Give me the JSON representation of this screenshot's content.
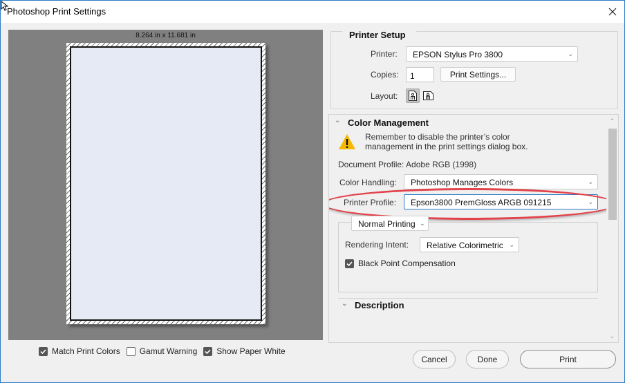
{
  "window": {
    "title": "Photoshop Print Settings",
    "close_icon": "close-x-icon"
  },
  "preview": {
    "paper_dimensions": "8.264 in x 11.681 in",
    "paper_color": "#e6eaf4",
    "background_color": "#808080"
  },
  "preview_options": [
    {
      "label": "Match Print Colors",
      "checked": true
    },
    {
      "label": "Gamut Warning",
      "checked": false
    },
    {
      "label": "Show Paper White",
      "checked": true
    }
  ],
  "printer_setup": {
    "heading": "Printer Setup",
    "printer_label": "Printer:",
    "printer_value": "EPSON Stylus Pro 3800",
    "copies_label": "Copies:",
    "copies_value": "1",
    "print_settings_button": "Print Settings...",
    "layout_label": "Layout:",
    "layout_options": [
      {
        "name": "portrait",
        "icon": "portrait-layout-icon",
        "selected": true
      },
      {
        "name": "landscape",
        "icon": "landscape-layout-icon",
        "selected": false
      }
    ]
  },
  "color_management": {
    "heading": "Color Management",
    "warning_icon": "warning-triangle-icon",
    "warning_text_line1": "Remember to disable the printer’s color",
    "warning_text_line2": "management in the print settings dialog box.",
    "document_profile": "Document Profile: Adobe RGB (1998)",
    "color_handling_label": "Color Handling:",
    "color_handling_value": "Photoshop Manages Colors",
    "printer_profile_label": "Printer Profile:",
    "printer_profile_value": "Epson3800 PremGloss ARGB 091215",
    "highlight_color": "#e2434b",
    "print_mode_value": "Normal Printing",
    "rendering_intent_label": "Rendering Intent:",
    "rendering_intent_value": "Relative Colorimetric",
    "black_point_label": "Black Point Compensation",
    "black_point_checked": true
  },
  "description": {
    "heading": "Description"
  },
  "buttons": {
    "cancel": "Cancel",
    "done": "Done",
    "print": "Print"
  }
}
